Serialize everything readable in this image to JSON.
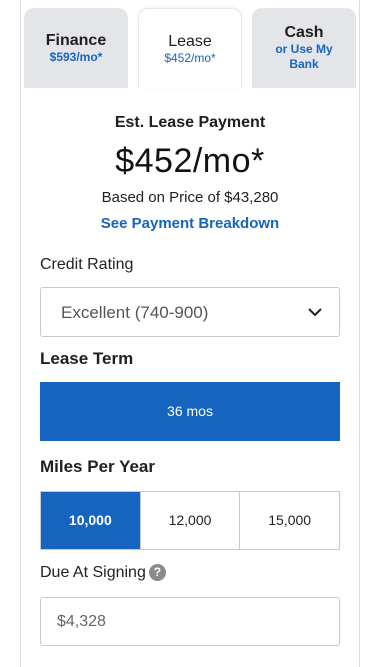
{
  "tabs": [
    {
      "title": "Finance",
      "sub": "$593/mo*"
    },
    {
      "title": "Lease",
      "sub": "$452/mo*"
    },
    {
      "title": "Cash",
      "sub_line1": "or Use My",
      "sub_line2": "Bank"
    }
  ],
  "active_tab": "Lease",
  "summary": {
    "label": "Est. Lease Payment",
    "amount": "$452/mo*",
    "based_on": "Based on Price of $43,280",
    "breakdown_link": "See Payment Breakdown"
  },
  "credit": {
    "label": "Credit Rating",
    "selected": "Excellent (740-900)"
  },
  "lease_term": {
    "label": "Lease Term",
    "options": [
      "36 mos"
    ],
    "selected": "36 mos"
  },
  "miles": {
    "label": "Miles Per Year",
    "options": [
      "10,000",
      "12,000",
      "15,000"
    ],
    "selected": "10,000"
  },
  "due_at_signing": {
    "label": "Due At Signing",
    "help_icon": "question-icon",
    "value": "$4,328"
  },
  "colors": {
    "accent": "#1565c0",
    "tab_inactive_bg": "#e4e5e8",
    "help_icon_bg": "#8a8a8a"
  }
}
